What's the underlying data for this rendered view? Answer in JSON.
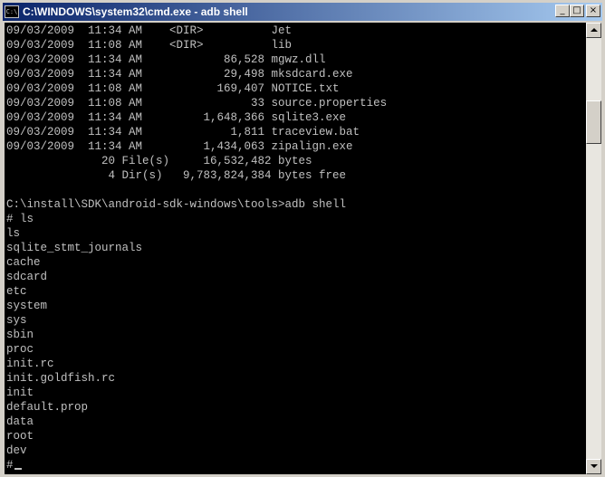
{
  "window": {
    "title": "C:\\WINDOWS\\system32\\cmd.exe - adb shell",
    "icon_label": "C:\\",
    "minimize_glyph": "_",
    "maximize_glyph": "□",
    "close_glyph": "×"
  },
  "console": {
    "lines": [
      "09/03/2009  11:34 AM    <DIR>          Jet",
      "09/03/2009  11:08 AM    <DIR>          lib",
      "09/03/2009  11:34 AM            86,528 mgwz.dll",
      "09/03/2009  11:34 AM            29,498 mksdcard.exe",
      "09/03/2009  11:08 AM           169,407 NOTICE.txt",
      "09/03/2009  11:08 AM                33 source.properties",
      "09/03/2009  11:34 AM         1,648,366 sqlite3.exe",
      "09/03/2009  11:34 AM             1,811 traceview.bat",
      "09/03/2009  11:34 AM         1,434,063 zipalign.exe",
      "              20 File(s)     16,532,482 bytes",
      "               4 Dir(s)   9,783,824,384 bytes free",
      "",
      "C:\\install\\SDK\\android-sdk-windows\\tools>adb shell",
      "# ls",
      "ls",
      "sqlite_stmt_journals",
      "cache",
      "sdcard",
      "etc",
      "system",
      "sys",
      "sbin",
      "proc",
      "init.rc",
      "init.goldfish.rc",
      "init",
      "default.prop",
      "data",
      "root",
      "dev"
    ],
    "prompt": "#"
  },
  "colors": {
    "console_bg": "#000000",
    "console_fg": "#c0c0c0",
    "title_active": "#0a246a"
  }
}
